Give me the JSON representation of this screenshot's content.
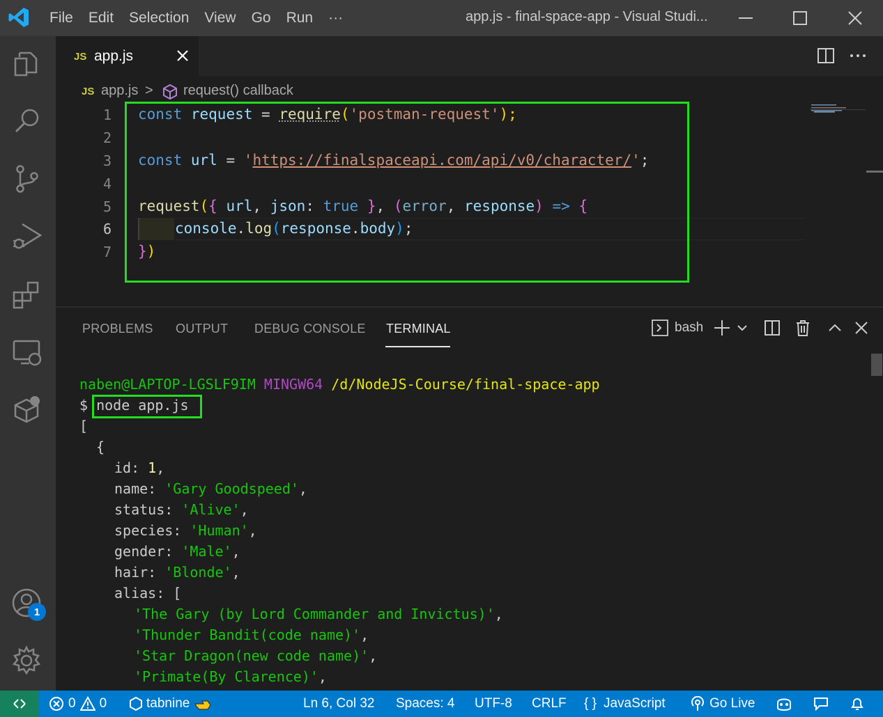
{
  "window": {
    "menu": [
      "File",
      "Edit",
      "Selection",
      "View",
      "Go",
      "Run",
      "···"
    ],
    "title": "app.js - final-space-app - Visual Studi..."
  },
  "tabs": [
    {
      "icon": "JS",
      "label": "app.js"
    }
  ],
  "breadcrumb": {
    "icon": "JS",
    "file": "app.js",
    "separator": ">",
    "symbol": "request() callback"
  },
  "editor": {
    "line_numbers": [
      "1",
      "2",
      "3",
      "4",
      "5",
      "6",
      "7"
    ],
    "active_line": "6",
    "code": {
      "l1": {
        "kw": "const",
        "var": "request",
        "eq": "=",
        "fn": "require",
        "open": "(",
        "str": "'postman-request'",
        "close": ");"
      },
      "l3": {
        "kw": "const",
        "var": "url",
        "eq": "=",
        "q1": "'",
        "str": "https://finalspaceapi.com/api/v0/character/",
        "q2": "'",
        "end": ";"
      },
      "l5": {
        "fn": "request",
        "p1": "(",
        "b1": "{",
        "a": "url",
        "c1": ",",
        "b": "json",
        "c2": ":",
        "t": "true",
        "b2": "}",
        "c3": ",",
        "p2": "(",
        "e": "error",
        "c4": ",",
        "r": "response",
        "p3": ")",
        "arrow": "=>",
        "b3": "{"
      },
      "l6": {
        "obj": "console",
        "dot1": ".",
        "fn": "log",
        "p1": "(",
        "a": "response",
        "dot2": ".",
        "b": "body",
        "p2": ")",
        "end": ";"
      },
      "l7": {
        "b": "}",
        "p": ")"
      }
    }
  },
  "panel": {
    "tabs": [
      "PROBLEMS",
      "OUTPUT",
      "DEBUG CONSOLE",
      "TERMINAL"
    ],
    "active_tab": "TERMINAL",
    "shell": "bash"
  },
  "terminal": {
    "prompt_user": "naben@LAPTOP-LGSLF9IM",
    "prompt_env": "MINGW64",
    "prompt_path": "/d/NodeJS-Course/final-space-app",
    "dollar": "$",
    "command": "node app.js",
    "open_bracket": "[",
    "open_brace": "{",
    "id_key": "id:",
    "id_val": "1",
    "name_key": "name:",
    "name_val": "'Gary Goodspeed'",
    "status_key": "status:",
    "status_val": "'Alive'",
    "species_key": "species:",
    "species_val": "'Human'",
    "gender_key": "gender:",
    "gender_val": "'Male'",
    "hair_key": "hair:",
    "hair_val": "'Blonde'",
    "alias_key": "alias: [",
    "aliases": [
      "'The Gary (by Lord Commander and Invictus)'",
      "'Thunder Bandit(code name)'",
      "'Star Dragon(new code name)'",
      "'Primate(By Clarence)'"
    ]
  },
  "statusbar": {
    "errors": "0",
    "warnings": "0",
    "tabnine": "tabnine",
    "position": "Ln 6, Col 32",
    "spaces": "Spaces: 4",
    "encoding": "UTF-8",
    "eol": "CRLF",
    "language_icon": "{ }",
    "language": "JavaScript",
    "golive": "Go Live"
  },
  "accounts_badge": "1",
  "colors": {
    "highlight_box": "#22dd22",
    "statusbar": "#007acc",
    "titlebar": "#3c3c3c"
  }
}
